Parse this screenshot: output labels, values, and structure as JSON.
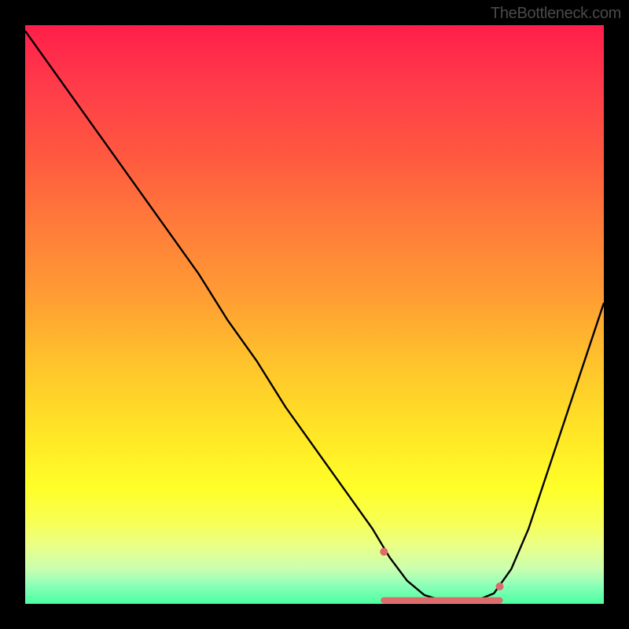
{
  "watermark": "TheBottleneck.com",
  "chart_data": {
    "type": "line",
    "title": "",
    "xlabel": "",
    "ylabel": "",
    "xlim": [
      0,
      100
    ],
    "ylim": [
      0,
      100
    ],
    "grid": false,
    "legend": false,
    "series": [
      {
        "name": "bottleneck-curve",
        "x": [
          0,
          5,
          10,
          15,
          20,
          25,
          30,
          35,
          40,
          45,
          50,
          55,
          60,
          63,
          66,
          69,
          72,
          75,
          78,
          81,
          84,
          87,
          90,
          93,
          96,
          100
        ],
        "y": [
          99,
          92,
          85,
          78,
          71,
          64,
          57,
          49,
          42,
          34,
          27,
          20,
          13,
          8,
          4,
          1.5,
          0.6,
          0.3,
          0.6,
          1.8,
          6,
          13,
          22,
          31,
          40,
          52
        ]
      }
    ],
    "highlight_band": {
      "x_start": 62,
      "x_end": 82,
      "y": 0.6
    },
    "highlight_points": [
      {
        "x": 62,
        "y": 9
      },
      {
        "x": 82,
        "y": 3
      }
    ]
  }
}
